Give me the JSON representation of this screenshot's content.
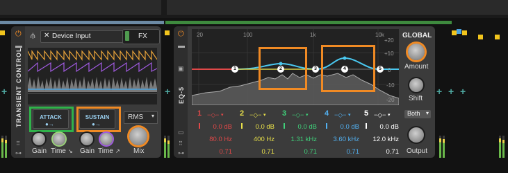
{
  "transient": {
    "rail_title": "TRANSIENT CONTROL",
    "device_input": "Device Input",
    "fx_label": "FX",
    "attack_label": "ATTACK",
    "sustain_label": "SUSTAIN",
    "rms_label": "RMS",
    "gain1_label": "Gain",
    "time1_label": "Time",
    "gain2_label": "Gain",
    "time2_label": "Time",
    "mix_label": "Mix"
  },
  "eq": {
    "rail_title": "EQ-5",
    "freq_ticks": [
      "20",
      "100",
      "1k",
      "10k"
    ],
    "db_ticks": [
      "+20",
      "+10",
      "0",
      "-10",
      "-20"
    ],
    "nodes": [
      "1",
      "2",
      "3",
      "4",
      "5"
    ],
    "bands": [
      {
        "num": "1",
        "gain": "0.0 dB",
        "freq": "80.0 Hz",
        "q": "0.71",
        "color": "#e04848"
      },
      {
        "num": "2",
        "gain": "0.0 dB",
        "freq": "400 Hz",
        "q": "0.71",
        "color": "#e8e04a"
      },
      {
        "num": "3",
        "gain": "0.0 dB",
        "freq": "1.31 kHz",
        "q": "0.71",
        "color": "#3fd07a"
      },
      {
        "num": "4",
        "gain": "0.0 dB",
        "freq": "3.60 kHz",
        "q": "0.71",
        "color": "#52b0f0"
      },
      {
        "num": "5",
        "gain": "0.0 dB",
        "freq": "12.0 kHz",
        "q": "0.71",
        "color": "#ffffff"
      }
    ]
  },
  "global": {
    "title": "GLOBAL",
    "amount_label": "Amount",
    "shift_label": "Shift",
    "both_label": "Both",
    "output_label": "Output"
  },
  "colors": {
    "accent_orange": "#f08a24",
    "highlight_green": "#2fb34a",
    "curve_cyan": "#4ac8f0",
    "panel": "#3b3b3b"
  }
}
